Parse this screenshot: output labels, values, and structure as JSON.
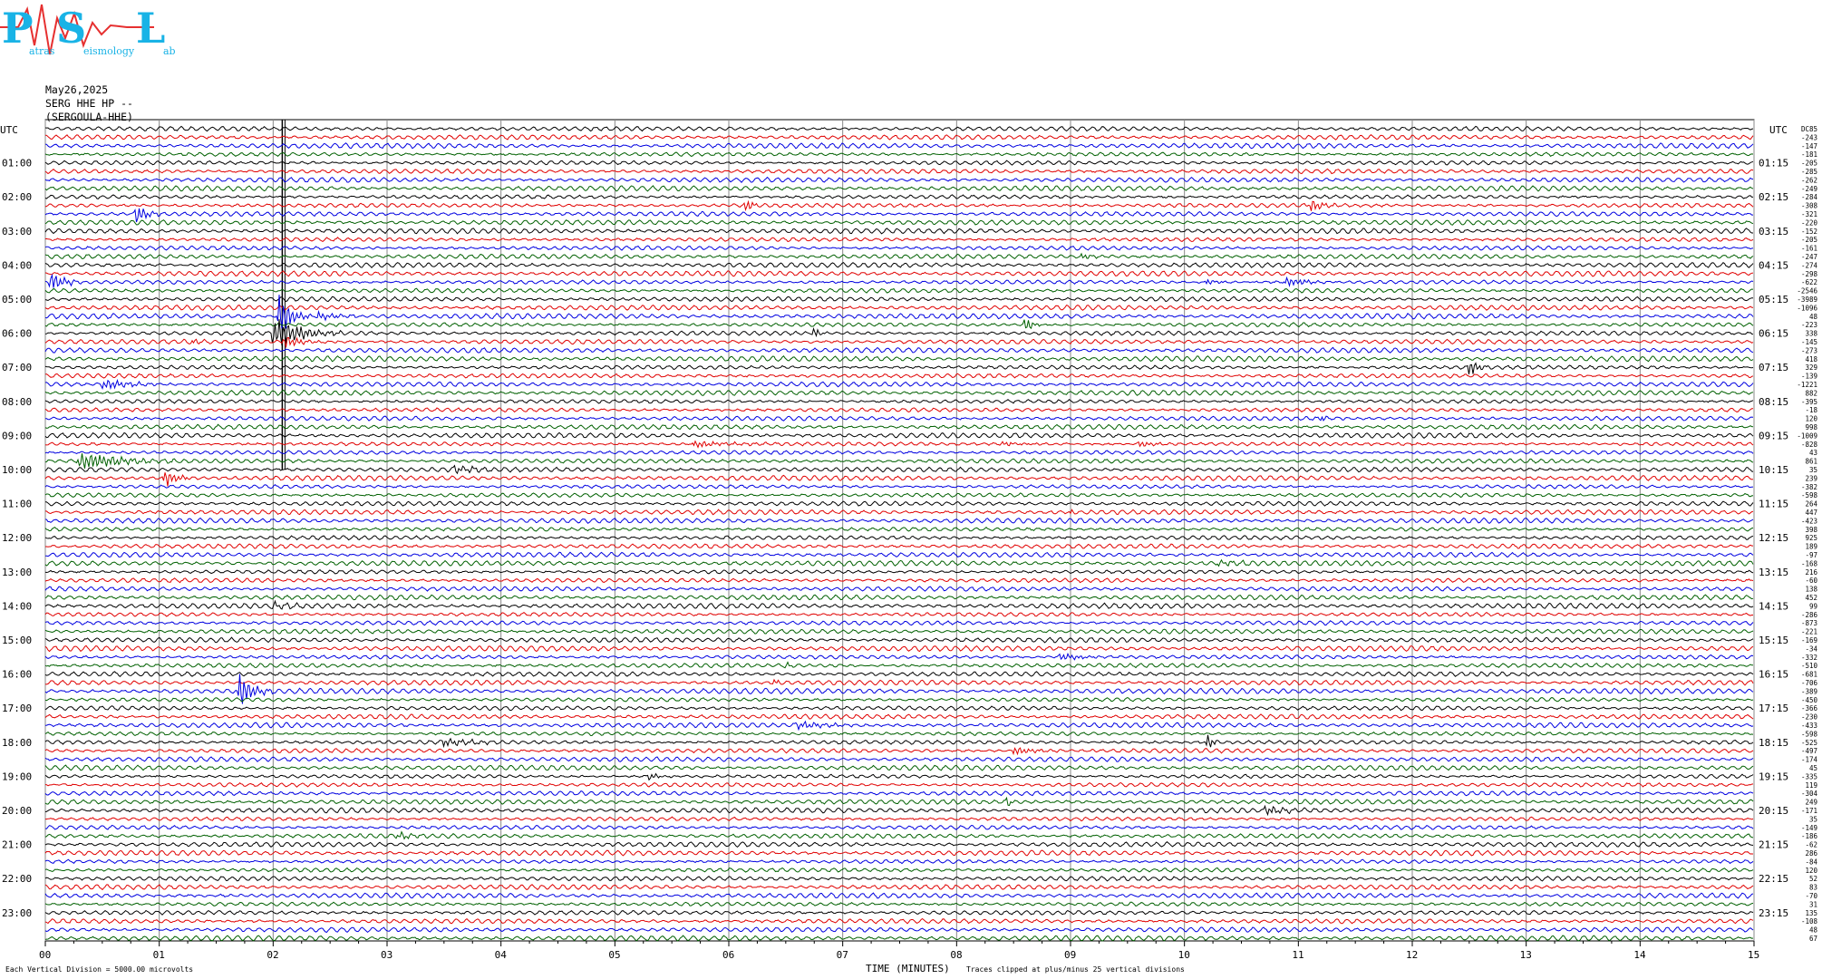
{
  "logo": {
    "letters": [
      "P",
      "S",
      "L"
    ],
    "small_text": [
      "atras",
      "eismology",
      "ab"
    ]
  },
  "header": {
    "date": "May26,2025",
    "station": "SERG HHE HP --",
    "station_name": "(SERGOULA-HHE)"
  },
  "utc_left": "UTC",
  "utc_right": "UTC",
  "footer": {
    "left": "Each Vertical Division = 5000.00 microvolts",
    "xlabel": "TIME (MINUTES)",
    "clip_note": "Traces clipped at plus/minus 25 vertical divisions"
  },
  "chart_data": {
    "type": "line",
    "title": "",
    "xlabel": "TIME (MINUTES)",
    "ylabel": "",
    "xlim": [
      0,
      15
    ],
    "x_ticks": [
      "00",
      "01",
      "02",
      "03",
      "04",
      "05",
      "06",
      "07",
      "08",
      "09",
      "10",
      "11",
      "12",
      "13",
      "14",
      "15"
    ],
    "left_hour_labels": [
      "01:00",
      "02:00",
      "03:00",
      "04:00",
      "05:00",
      "06:00",
      "07:00",
      "08:00",
      "09:00",
      "10:00",
      "11:00",
      "12:00",
      "13:00",
      "14:00",
      "15:00",
      "16:00",
      "17:00",
      "18:00",
      "19:00",
      "20:00",
      "21:00",
      "22:00",
      "23:00"
    ],
    "right_hour_labels": [
      "01:15",
      "02:15",
      "03:15",
      "04:15",
      "05:15",
      "06:15",
      "07:15",
      "08:15",
      "09:15",
      "10:15",
      "11:15",
      "12:15",
      "13:15",
      "14:15",
      "15:15",
      "16:15",
      "17:15",
      "18:15",
      "19:15",
      "20:15",
      "21:15",
      "22:15",
      "23:15"
    ],
    "trace_colors": [
      "#000000",
      "#e00000",
      "#0000e0",
      "#006000"
    ],
    "trace_count": 96,
    "trace_dc_offsets": [
      "DC85",
      "-243",
      "-147",
      "-181",
      "-205",
      "-285",
      "-262",
      "-249",
      "-284",
      "-308",
      "-321",
      "-220",
      "-152",
      "-205",
      "-161",
      "-247",
      "-274",
      "-298",
      "-622",
      "-2546",
      "-3989",
      "-1096",
      "48",
      "-223",
      "338",
      "-145",
      "-273",
      "418",
      "329",
      "-139",
      "-1221",
      "882",
      "-395",
      "-18",
      "120",
      "998",
      "-1009",
      "-828",
      "43",
      "861",
      "35",
      "239",
      "-382",
      "-598",
      "264",
      "447",
      "-423",
      "398",
      "925",
      "189",
      "-97",
      "-168",
      "216",
      "-60",
      "138",
      "452",
      "99",
      "-286",
      "-873",
      "-221",
      "-169",
      "-34",
      "-332",
      "-510",
      "-681",
      "-706",
      "-389",
      "-450",
      "-366",
      "-230",
      "-433",
      "-598",
      "-525",
      "-497",
      "-174",
      "45",
      "-335",
      "119",
      "-304",
      "249",
      "-171",
      "35",
      "-149",
      "-186",
      "-62",
      "286",
      "-84",
      "120",
      "52",
      "83",
      "-70",
      "31",
      "135",
      "-108",
      "48",
      "67"
    ],
    "events": [
      {
        "trace": 0,
        "minute": 2.08,
        "amp": 1.0,
        "len": 0.05,
        "clipped": true,
        "span": 40
      },
      {
        "trace": 10,
        "minute": 0.8,
        "amp": 12,
        "len": 0.25
      },
      {
        "trace": 9,
        "minute": 6.15,
        "amp": 8,
        "len": 0.15
      },
      {
        "trace": 9,
        "minute": 11.1,
        "amp": 8,
        "len": 0.3
      },
      {
        "trace": 15,
        "minute": 9.1,
        "amp": 4,
        "len": 0.3
      },
      {
        "trace": 18,
        "minute": 0.05,
        "amp": 14,
        "len": 0.3
      },
      {
        "trace": 18,
        "minute": 10.2,
        "amp": 4,
        "len": 0.2
      },
      {
        "trace": 18,
        "minute": 10.9,
        "amp": 6,
        "len": 0.5
      },
      {
        "trace": 22,
        "minute": 2.05,
        "amp": 25,
        "len": 0.3
      },
      {
        "trace": 22,
        "minute": 2.4,
        "amp": 6,
        "len": 0.4
      },
      {
        "trace": 23,
        "minute": 8.6,
        "amp": 10,
        "len": 0.2
      },
      {
        "trace": 24,
        "minute": 2.0,
        "amp": 22,
        "len": 0.6
      },
      {
        "trace": 24,
        "minute": 6.75,
        "amp": 9,
        "len": 0.1
      },
      {
        "trace": 25,
        "minute": 1.3,
        "amp": 4,
        "len": 0.15
      },
      {
        "trace": 25,
        "minute": 2.1,
        "amp": 8,
        "len": 0.4
      },
      {
        "trace": 28,
        "minute": 12.5,
        "amp": 12,
        "len": 0.2
      },
      {
        "trace": 30,
        "minute": 0.5,
        "amp": 6,
        "len": 0.7
      },
      {
        "trace": 34,
        "minute": 11.2,
        "amp": 4,
        "len": 0.1
      },
      {
        "trace": 37,
        "minute": 5.7,
        "amp": 4,
        "len": 0.8
      },
      {
        "trace": 37,
        "minute": 8.4,
        "amp": 3,
        "len": 0.5
      },
      {
        "trace": 37,
        "minute": 9.6,
        "amp": 5,
        "len": 0.3
      },
      {
        "trace": 39,
        "minute": 0.3,
        "amp": 12,
        "len": 0.9
      },
      {
        "trace": 40,
        "minute": 3.6,
        "amp": 5,
        "len": 0.5
      },
      {
        "trace": 41,
        "minute": 1.05,
        "amp": 12,
        "len": 0.25
      },
      {
        "trace": 45,
        "minute": 9.0,
        "amp": 5,
        "len": 0.06
      },
      {
        "trace": 51,
        "minute": 10.3,
        "amp": 3,
        "len": 0.5
      },
      {
        "trace": 56,
        "minute": 2.0,
        "amp": 4,
        "len": 0.4
      },
      {
        "trace": 62,
        "minute": 8.9,
        "amp": 4,
        "len": 0.6
      },
      {
        "trace": 63,
        "minute": 6.5,
        "amp": 5,
        "len": 0.1
      },
      {
        "trace": 65,
        "minute": 6.4,
        "amp": 4,
        "len": 0.1
      },
      {
        "trace": 66,
        "minute": 1.7,
        "amp": 22,
        "len": 0.3
      },
      {
        "trace": 70,
        "minute": 6.6,
        "amp": 5,
        "len": 0.6
      },
      {
        "trace": 72,
        "minute": 3.5,
        "amp": 5,
        "len": 0.6
      },
      {
        "trace": 72,
        "minute": 10.2,
        "amp": 12,
        "len": 0.1
      },
      {
        "trace": 73,
        "minute": 8.5,
        "amp": 6,
        "len": 0.4
      },
      {
        "trace": 76,
        "minute": 5.3,
        "amp": 4,
        "len": 0.3
      },
      {
        "trace": 79,
        "minute": 8.45,
        "amp": 8,
        "len": 0.05
      },
      {
        "trace": 80,
        "minute": 10.7,
        "amp": 5,
        "len": 0.5
      },
      {
        "trace": 83,
        "minute": 3.1,
        "amp": 4,
        "len": 0.4
      }
    ]
  }
}
